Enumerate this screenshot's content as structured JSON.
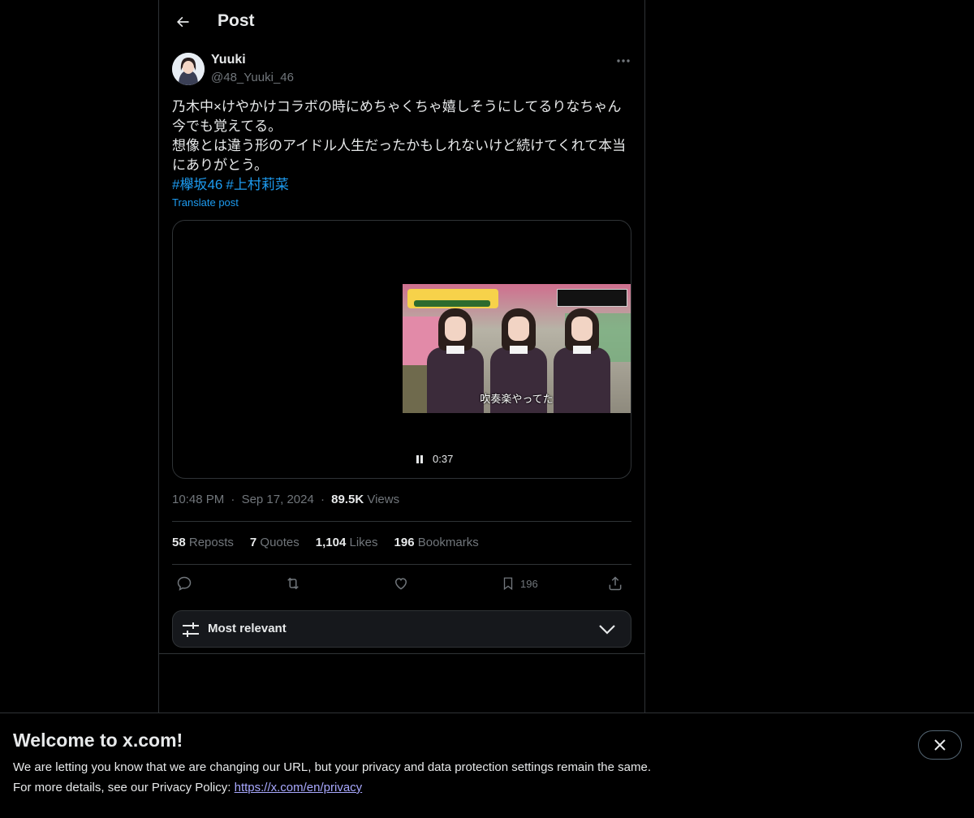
{
  "header": {
    "title": "Post"
  },
  "author": {
    "display_name": "Yuuki",
    "handle": "@48_Yuuki_46"
  },
  "tweet": {
    "text": "乃木中×けやかけコラボの時にめちゃくちゃ嬉しそうにしてるりなちゃん\n今でも覚えてる。\n想像とは違う形のアイドル人生だったかもしれないけど続けてくれて本当\nにありがとう。",
    "hashtags": [
      "#欅坂46",
      "#上村莉菜"
    ],
    "translate_label": "Translate post"
  },
  "media": {
    "subtitle": "吹奏楽やってた",
    "time": "0:37"
  },
  "meta": {
    "time": "10:48 PM",
    "separator": "·",
    "date": "Sep 17, 2024",
    "views_count": "89.5K",
    "views_label": "Views"
  },
  "stats": {
    "reposts_count": "58",
    "reposts_label": "Reposts",
    "quotes_count": "7",
    "quotes_label": "Quotes",
    "likes_count": "1,104",
    "likes_label": "Likes",
    "bookmarks_count": "196",
    "bookmarks_label": "Bookmarks"
  },
  "actions": {
    "bookmark_count": "196",
    "icons": [
      "reply-icon",
      "repost-icon",
      "like-icon",
      "bookmark-icon",
      "share-icon"
    ]
  },
  "sort": {
    "label": "Most relevant"
  },
  "banner": {
    "title": "Welcome to x.com!",
    "line1": "We are letting you know that we are changing our URL, but your privacy and data protection settings remain the same.",
    "line2_prefix": "For more details, see our Privacy Policy:",
    "link": "https://x.com/en/privacy"
  },
  "colors": {
    "background": "#000000",
    "text": "#e7e9ea",
    "muted": "#71767b",
    "accent": "#1d9bf0",
    "border": "#2f3336"
  }
}
